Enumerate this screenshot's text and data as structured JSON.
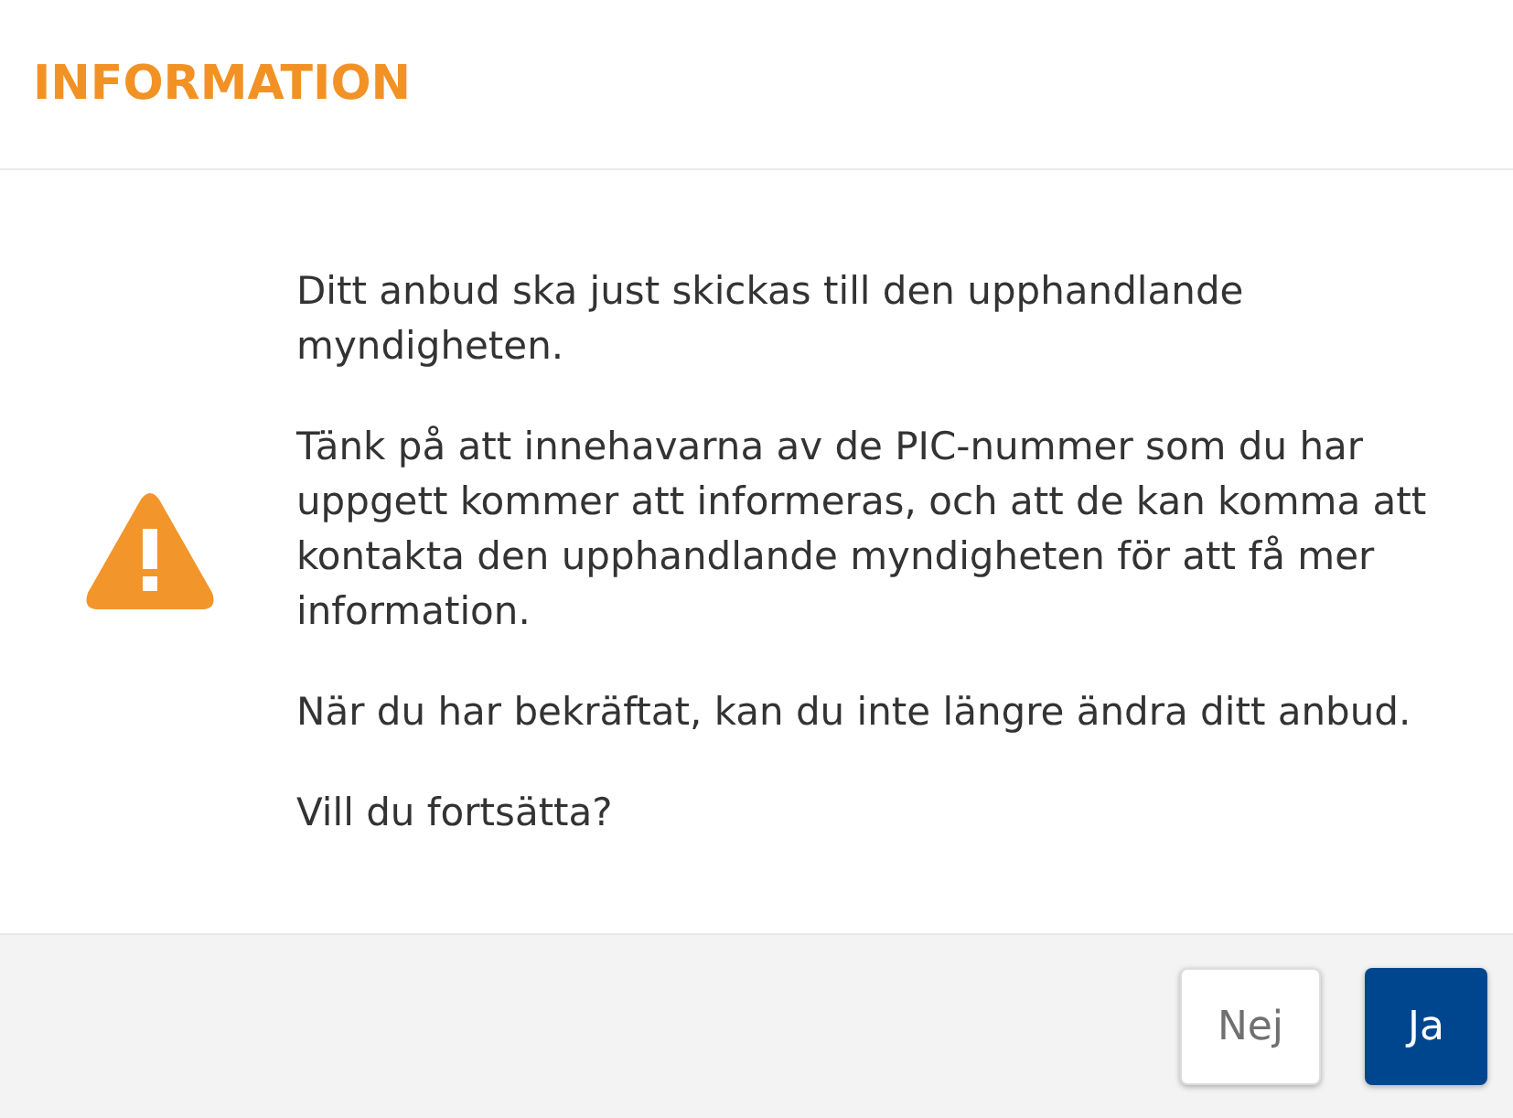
{
  "dialog": {
    "title": "INFORMATION",
    "paragraphs": [
      "Ditt anbud ska just skickas till den upphandlande myndigheten.",
      "Tänk på att innehavarna av de PIC-nummer som du har uppgett kommer att informeras, och att de kan komma att kontakta den upphandlande myndigheten för att få mer information.",
      "När du har bekräftat, kan du inte längre ändra ditt anbud.",
      "Vill du fortsätta?"
    ],
    "buttons": [
      {
        "label": "Nej",
        "kind": "secondary"
      },
      {
        "label": "Ja",
        "kind": "primary"
      }
    ]
  }
}
